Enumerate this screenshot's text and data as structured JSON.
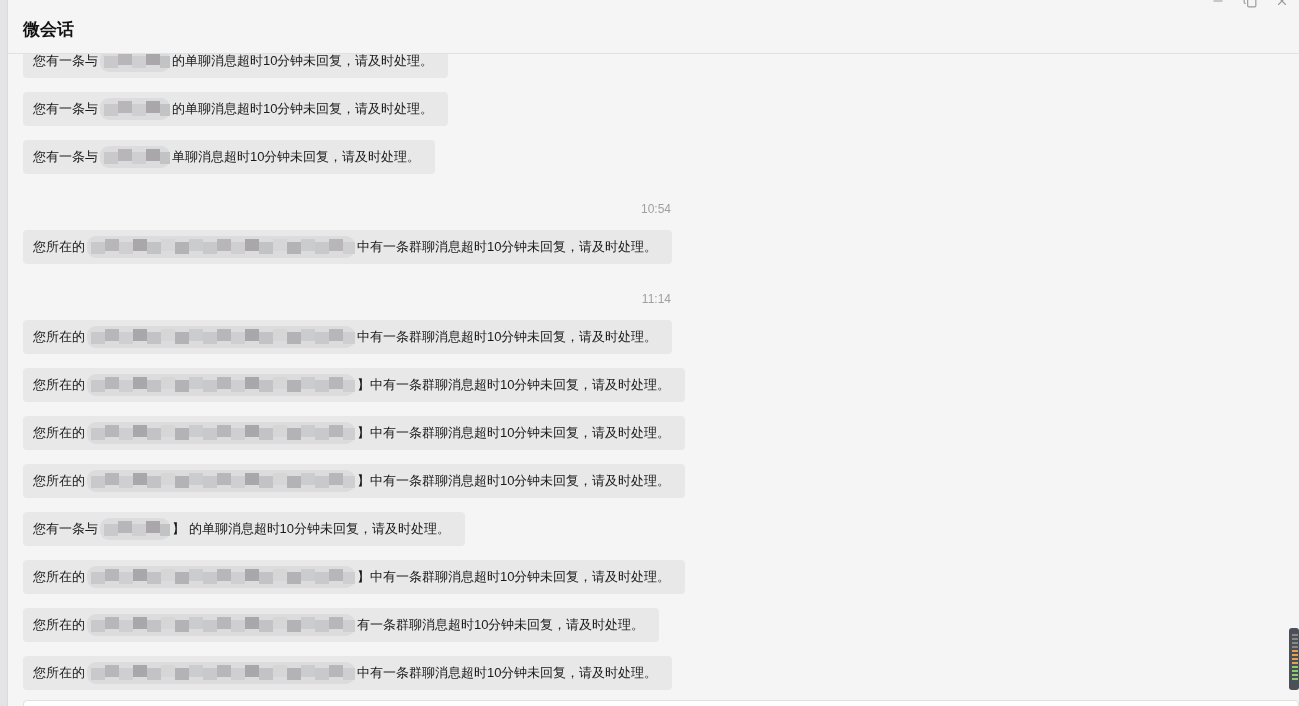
{
  "window": {
    "title": "微会话"
  },
  "messages": [
    {
      "kind": "single",
      "prefix": "您有一条与",
      "suffix": "的单聊消息超时10分钟未回复，请及时处理。"
    },
    {
      "kind": "single",
      "prefix": "您有一条与",
      "suffix": "的单聊消息超时10分钟未回复，请及时处理。"
    },
    {
      "kind": "single",
      "prefix": "您有一条与",
      "suffix": "单聊消息超时10分钟未回复，请及时处理。"
    },
    {
      "kind": "time",
      "text": "10:54"
    },
    {
      "kind": "group",
      "prefix": "您所在的",
      "suffix": "中有一条群聊消息超时10分钟未回复，请及时处理。"
    },
    {
      "kind": "time",
      "text": "11:14"
    },
    {
      "kind": "group",
      "prefix": "您所在的",
      "suffix": "中有一条群聊消息超时10分钟未回复，请及时处理。"
    },
    {
      "kind": "group",
      "prefix": "您所在的",
      "suffix": "】中有一条群聊消息超时10分钟未回复，请及时处理。"
    },
    {
      "kind": "group",
      "prefix": "您所在的",
      "suffix": "】中有一条群聊消息超时10分钟未回复，请及时处理。"
    },
    {
      "kind": "group",
      "prefix": "您所在的",
      "suffix": "】中有一条群聊消息超时10分钟未回复，请及时处理。"
    },
    {
      "kind": "single",
      "prefix": "您有一条与",
      "suffix": "】 的单聊消息超时10分钟未回复，请及时处理。"
    },
    {
      "kind": "group",
      "prefix": "您所在的",
      "suffix": "】中有一条群聊消息超时10分钟未回复，请及时处理。"
    },
    {
      "kind": "group",
      "prefix": "您所在的",
      "suffix": "有一条群聊消息超时10分钟未回复，请及时处理。"
    },
    {
      "kind": "group",
      "prefix": "您所在的",
      "suffix": "中有一条群聊消息超时10分钟未回复，请及时处理。"
    }
  ]
}
